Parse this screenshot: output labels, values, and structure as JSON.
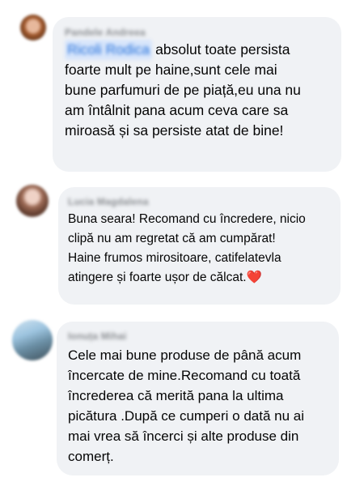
{
  "comments": [
    {
      "author": "Pandele Andreea",
      "mention": "Ricoli Rodica",
      "lines": [
        "absolut toate persista",
        "foarte mult pe haine,sunt cele mai",
        "bune parfumuri de pe piață,eu una nu",
        "am întâlnit pana acum ceva care sa",
        "miroasă și sa persiste atat de bine!"
      ]
    },
    {
      "author": "Lucia Magdalena",
      "lines": [
        "Buna seara! Recomand cu încredere, nicio",
        "clipă nu am regretat că am cumpărat!",
        "Haine frumos mirositoare, catifelatevla",
        "atingere și foarte ușor de călcat."
      ],
      "emoji": "❤️"
    },
    {
      "author": "Ionuța Mihai",
      "lines": [
        "Cele mai bune produse de până acum",
        "încercate de mine.Recomand cu toată",
        "încrederea că merită pana la ultima",
        "picătura .După ce cumperi o dată nu  ai",
        "mai vrea să încerci și alte produse din",
        "comerț."
      ]
    }
  ]
}
